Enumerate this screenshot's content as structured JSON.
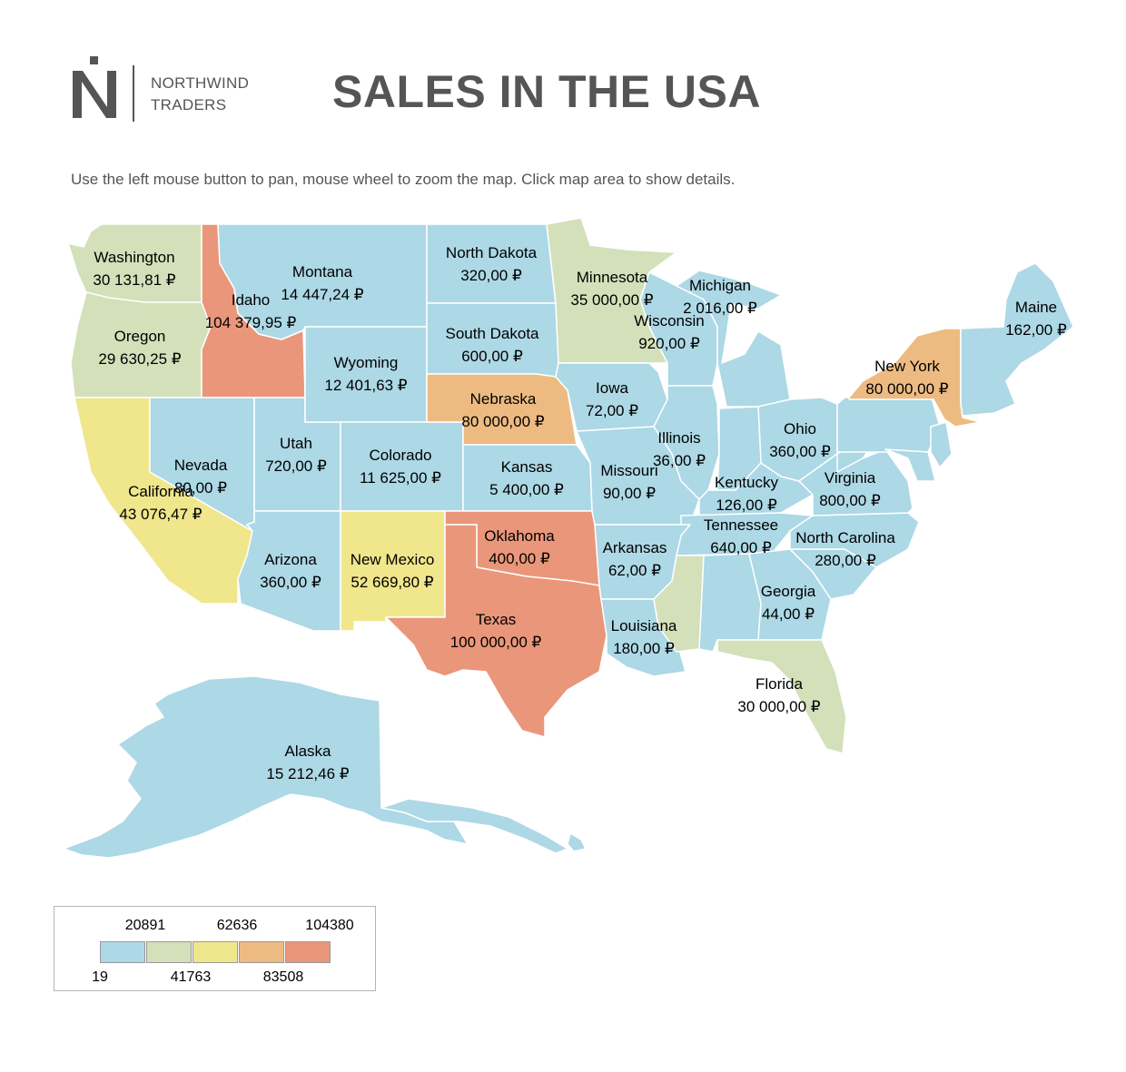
{
  "logo": {
    "line1": "NORTHWIND",
    "line2": "TRADERS",
    "mark": "N"
  },
  "title": "SALES IN THE USA",
  "hint": "Use the left mouse button to pan, mouse wheel to zoom the map. Click map area to show details.",
  "colors": {
    "c1": "#add8e6",
    "c2": "#d3e0b9",
    "c3": "#f0e68c",
    "c4": "#edbb82",
    "c5": "#ea967a",
    "text": "#555555"
  },
  "legend": {
    "top_ticks": [
      "20891",
      "62636",
      "104380"
    ],
    "bottom_ticks": [
      "19",
      "41763",
      "83508"
    ]
  },
  "states": {
    "washington": {
      "name": "Washington",
      "value": "30 131,81 ₽"
    },
    "oregon": {
      "name": "Oregon",
      "value": "29 630,25 ₽"
    },
    "idaho": {
      "name": "Idaho",
      "value": "104 379,95 ₽"
    },
    "montana": {
      "name": "Montana",
      "value": "14 447,24 ₽"
    },
    "north_dakota": {
      "name": "North Dakota",
      "value": "320,00 ₽"
    },
    "south_dakota": {
      "name": "South Dakota",
      "value": "600,00 ₽"
    },
    "minnesota": {
      "name": "Minnesota",
      "value": "35 000,00 ₽"
    },
    "michigan": {
      "name": "Michigan",
      "value": "2 016,00 ₽"
    },
    "wisconsin": {
      "name": "Wisconsin",
      "value": "920,00 ₽"
    },
    "maine": {
      "name": "Maine",
      "value": "162,00 ₽"
    },
    "wyoming": {
      "name": "Wyoming",
      "value": "12 401,63 ₽"
    },
    "nebraska": {
      "name": "Nebraska",
      "value": "80 000,00 ₽"
    },
    "iowa": {
      "name": "Iowa",
      "value": "72,00 ₽"
    },
    "new_york": {
      "name": "New York",
      "value": "80 000,00 ₽"
    },
    "nevada": {
      "name": "Nevada",
      "value": "80,00 ₽"
    },
    "utah": {
      "name": "Utah",
      "value": "720,00 ₽"
    },
    "colorado": {
      "name": "Colorado",
      "value": "11 625,00 ₽"
    },
    "kansas": {
      "name": "Kansas",
      "value": "5 400,00 ₽"
    },
    "missouri": {
      "name": "Missouri",
      "value": "90,00 ₽"
    },
    "illinois": {
      "name": "Illinois",
      "value": "36,00 ₽"
    },
    "ohio": {
      "name": "Ohio",
      "value": "360,00 ₽"
    },
    "kentucky": {
      "name": "Kentucky",
      "value": "126,00 ₽"
    },
    "virginia": {
      "name": "Virginia",
      "value": "800,00 ₽"
    },
    "california": {
      "name": "California",
      "value": "43 076,47 ₽"
    },
    "tennessee": {
      "name": "Tennessee",
      "value": "640,00 ₽"
    },
    "north_carolina": {
      "name": "North Carolina",
      "value": "280,00 ₽"
    },
    "arizona": {
      "name": "Arizona",
      "value": "360,00 ₽"
    },
    "new_mexico": {
      "name": "New Mexico",
      "value": "52 669,80 ₽"
    },
    "oklahoma": {
      "name": "Oklahoma",
      "value": "400,00 ₽"
    },
    "arkansas": {
      "name": "Arkansas",
      "value": "62,00 ₽"
    },
    "georgia": {
      "name": "Georgia",
      "value": "44,00 ₽"
    },
    "texas": {
      "name": "Texas",
      "value": "100 000,00 ₽"
    },
    "louisiana": {
      "name": "Louisiana",
      "value": "180,00 ₽"
    },
    "florida": {
      "name": "Florida",
      "value": "30 000,00 ₽"
    },
    "alaska": {
      "name": "Alaska",
      "value": "15 212,46 ₽"
    }
  }
}
